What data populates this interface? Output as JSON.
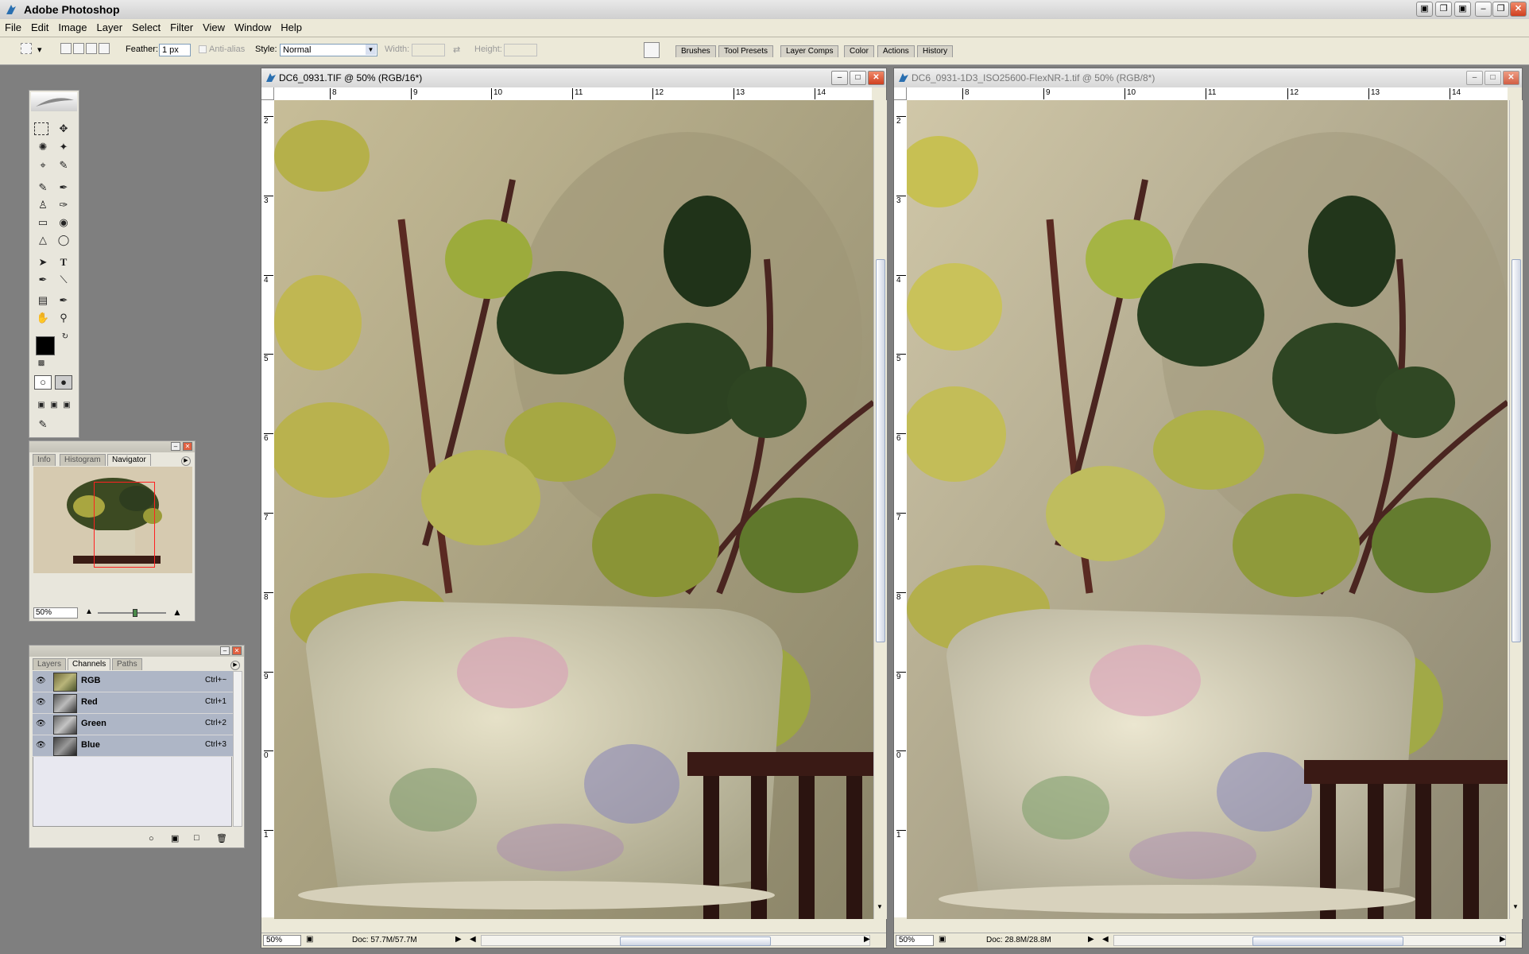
{
  "app": {
    "title": "Adobe Photoshop"
  },
  "menu": [
    "File",
    "Edit",
    "Image",
    "Layer",
    "Select",
    "Filter",
    "View",
    "Window",
    "Help"
  ],
  "options": {
    "feather_label": "Feather:",
    "feather_value": "1 px",
    "antialias_label": "Anti-alias",
    "style_label": "Style:",
    "style_value": "Normal",
    "width_label": "Width:",
    "height_label": "Height:"
  },
  "palette_well": [
    "Brushes",
    "Tool Presets",
    "Layer Comps",
    "Color",
    "Actions",
    "History"
  ],
  "navigator": {
    "tabs": [
      "Info",
      "Histogram",
      "Navigator"
    ],
    "active_tab": "Navigator",
    "zoom": "50%",
    "slider_level": 0.55
  },
  "channels": {
    "tabs": [
      "Layers",
      "Channels",
      "Paths"
    ],
    "active_tab": "Channels",
    "rows": [
      {
        "name": "RGB",
        "shortcut": "Ctrl+~"
      },
      {
        "name": "Red",
        "shortcut": "Ctrl+1"
      },
      {
        "name": "Green",
        "shortcut": "Ctrl+2"
      },
      {
        "name": "Blue",
        "shortcut": "Ctrl+3"
      }
    ]
  },
  "doc1": {
    "title": "DC6_0931.TIF @ 50% (RGB/16*)",
    "ruler_h": [
      "8",
      "9",
      "10",
      "11",
      "12",
      "13",
      "14"
    ],
    "ruler_v": [
      "2",
      "3",
      "4",
      "5",
      "6",
      "7",
      "8",
      "9",
      "0",
      "1"
    ],
    "zoom": "50%",
    "doc_size": "Doc: 57.7M/57.7M"
  },
  "doc2": {
    "title": "DC6_0931-1D3_ISO25600-FlexNR-1.tif @ 50% (RGB/8*)",
    "ruler_h": [
      "8",
      "9",
      "10",
      "11",
      "12",
      "13",
      "14"
    ],
    "ruler_v": [
      "2",
      "3",
      "4",
      "5",
      "6",
      "7",
      "8",
      "9",
      "0",
      "1"
    ],
    "zoom": "50%",
    "doc_size": "Doc: 28.8M/28.8M"
  },
  "colors": {
    "workspace": "#7f7f7f",
    "chrome": "#ece9d8",
    "channel_row": "#aeb6c6"
  }
}
